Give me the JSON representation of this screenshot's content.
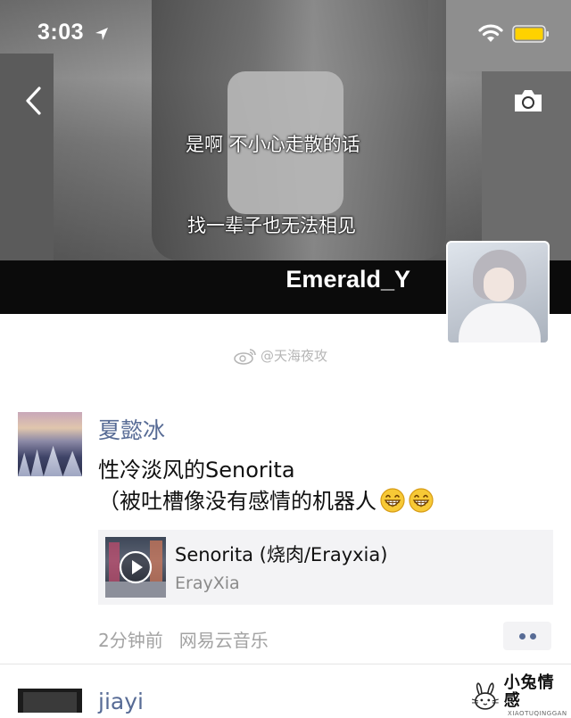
{
  "status_bar": {
    "time": "3:03",
    "icons": [
      "location-arrow-icon",
      "wifi-icon",
      "battery-icon"
    ]
  },
  "header": {
    "back_icon": "chevron-left-icon",
    "camera_icon": "camera-icon"
  },
  "cover": {
    "subtitle_line_1": "是啊 不小心走散的话",
    "subtitle_line_2": "找一辈子也无法相见",
    "username": "Emerald_Y"
  },
  "watermark": {
    "text": "@天海夜攻"
  },
  "post": {
    "author": "夏懿冰",
    "text_line_1": "性冷淡风的Senorita",
    "text_line_2": "（被吐槽像没有感情的机器人",
    "emoji": [
      "grin-emoji",
      "grin-emoji"
    ],
    "music": {
      "title": "Senorita (烧肉/Erayxia)",
      "artist": "ErayXia"
    },
    "time_ago": "2分钟前",
    "source": "网易云音乐"
  },
  "next_post": {
    "author": "jiayi"
  },
  "site_logo": {
    "name": "小兔情感",
    "subtitle": "XIAOTUQINGGAN"
  },
  "colors": {
    "link_blue": "#576b95",
    "meta_gray": "#a3a3a3",
    "card_bg": "#f3f3f5",
    "battery_yellow": "#ffd200"
  }
}
